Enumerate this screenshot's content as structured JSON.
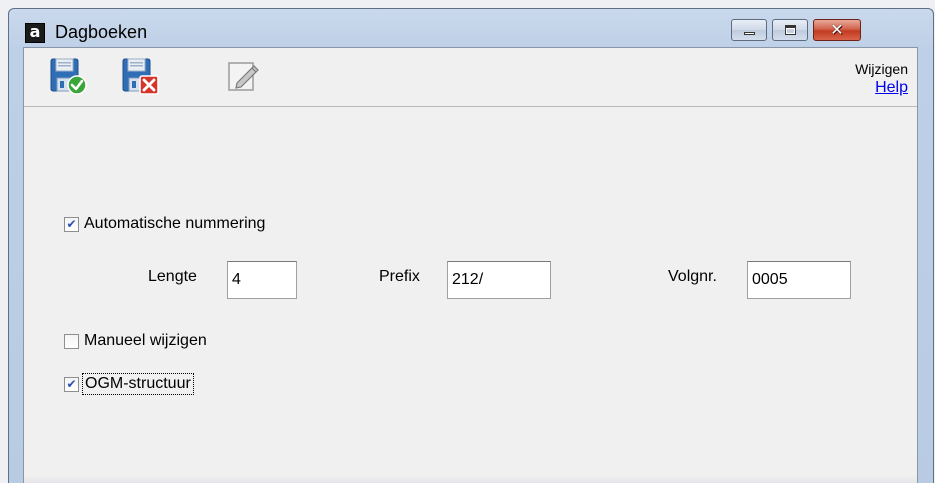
{
  "window": {
    "title": "Dagboeken",
    "app_icon_letter": "a",
    "controls": {
      "minimize": "minimize",
      "maximize": "maximize",
      "close": "close"
    }
  },
  "toolbar": {
    "buttons": [
      {
        "name": "save",
        "icon": "floppy-disk-check-icon",
        "enabled": true
      },
      {
        "name": "cancel",
        "icon": "floppy-disk-cross-icon",
        "enabled": true
      },
      {
        "name": "edit",
        "icon": "pencil-note-icon",
        "enabled": false
      }
    ],
    "mode_label": "Wijzigen",
    "help_link": "Help"
  },
  "form": {
    "auto_numbering": {
      "label": "Automatische nummering",
      "checked": true
    },
    "length": {
      "label": "Lengte",
      "value": "4"
    },
    "prefix": {
      "label": "Prefix",
      "value": "212/"
    },
    "sequence": {
      "label": "Volgnr.",
      "value": "0005"
    },
    "manual_edit": {
      "label": "Manueel wijzigen",
      "checked": false
    },
    "ogm_structure": {
      "label": "OGM-structuur",
      "checked": true,
      "focused": true
    }
  },
  "colors": {
    "frame": "#bed0e7",
    "client": "#f0f0f0",
    "checkmark": "#2b4fb3",
    "link": "#0000ee",
    "close_button": "#c13b22"
  }
}
